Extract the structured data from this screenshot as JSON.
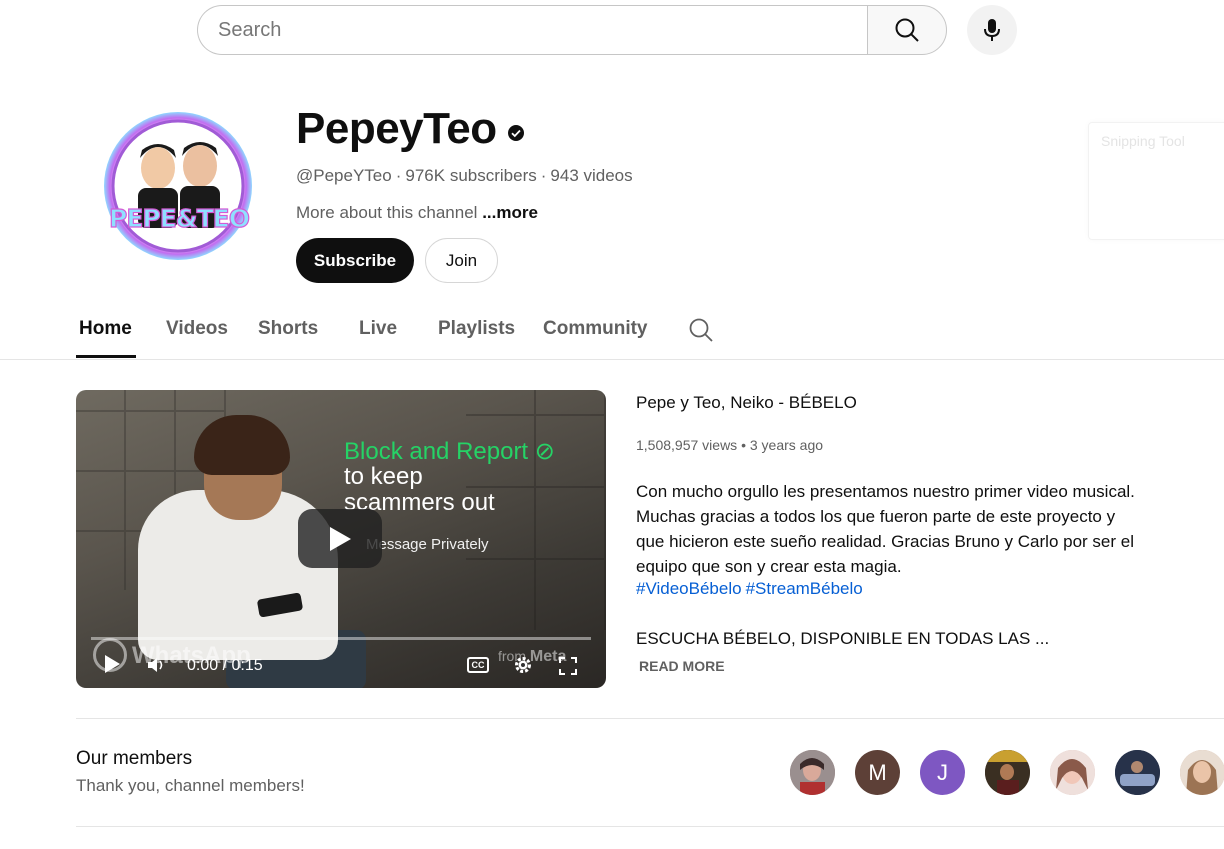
{
  "search": {
    "placeholder": "Search"
  },
  "snipping_tool": {
    "label": "Snipping Tool"
  },
  "channel": {
    "avatar_text": "PEPE&TEO",
    "name": "PepeyTeo",
    "handle": "@PepeYTeo",
    "subscribers": "976K subscribers",
    "videos": "943 videos",
    "about": "More about this channel",
    "about_more": "...more",
    "subscribe_label": "Subscribe",
    "join_label": "Join"
  },
  "tabs": [
    {
      "label": "Home",
      "active": true
    },
    {
      "label": "Videos",
      "active": false
    },
    {
      "label": "Shorts",
      "active": false
    },
    {
      "label": "Live",
      "active": false
    },
    {
      "label": "Playlists",
      "active": false
    },
    {
      "label": "Community",
      "active": false
    }
  ],
  "player": {
    "ad_line1": "Block and Report ⊘",
    "ad_line2": "to keep",
    "ad_line3": "scammers out",
    "ad_message": "Message Privately",
    "brand": "WhatsApp",
    "from_label": "from",
    "meta_label": "Meta",
    "time": "0:00 / 0:15",
    "cc_label": "CC"
  },
  "featured": {
    "title": "Pepe y Teo, Neiko - BÉBELO",
    "views": "1,508,957 views",
    "age": "3 years ago",
    "description": "Con mucho orgullo les presentamos nuestro primer video musical. Muchas gracias a todos los que fueron parte de este proyecto y que hicieron este sueño realidad. Gracias Bruno y Carlo por ser el equipo que son y crear esta magia.",
    "hashtags": [
      "#VideoBébelo",
      "#StreamBébelo"
    ],
    "description2": "ESCUCHA BÉBELO, DISPONIBLE EN TODAS LAS ...",
    "read_more": "READ MORE"
  },
  "members": {
    "title": "Our members",
    "subtitle": "Thank you, channel members!",
    "avatars": [
      {
        "letter": "",
        "color": "#8a6a6a"
      },
      {
        "letter": "M",
        "color": "#5d4037"
      },
      {
        "letter": "J",
        "color": "#7e57c2"
      },
      {
        "letter": "",
        "color": "#4a3a2a"
      },
      {
        "letter": "",
        "color": "#d9b8b0"
      },
      {
        "letter": "",
        "color": "#2d3a55"
      },
      {
        "letter": "",
        "color": "#c9a48a"
      }
    ]
  },
  "colors": {
    "link": "#065fd4",
    "whatsapp_green": "#25d366",
    "text_secondary": "#606060"
  }
}
